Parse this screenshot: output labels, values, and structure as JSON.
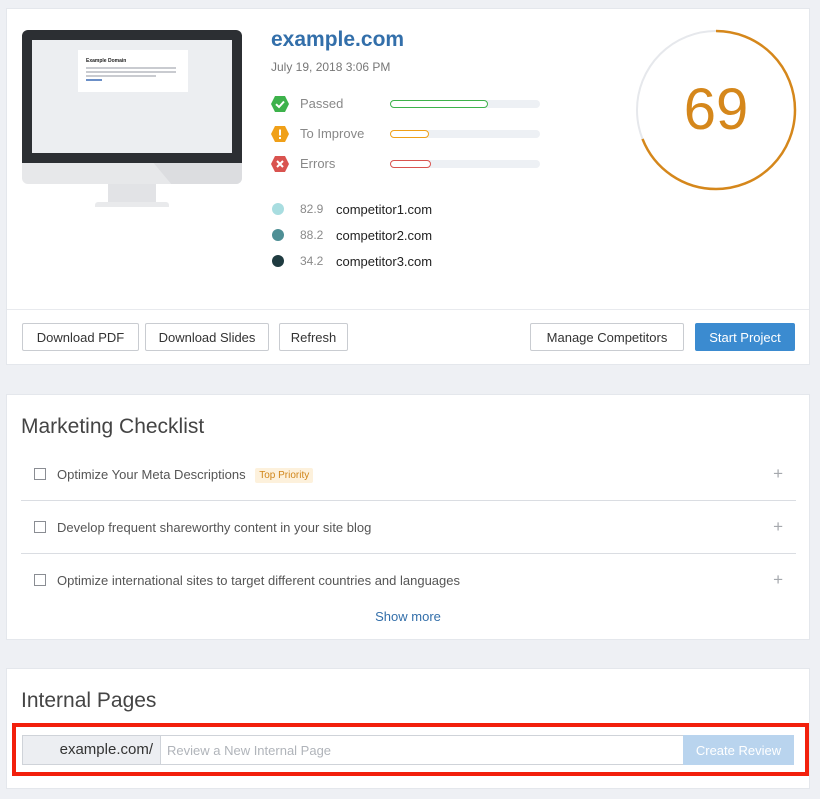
{
  "report": {
    "site_title": "example.com",
    "date": "July 19, 2018 3:06 PM",
    "preview": {
      "heading": "Example Domain"
    },
    "statuses": [
      {
        "label": "Passed",
        "icon": "check-circle-icon",
        "color": "#3db24b",
        "level": 0.65
      },
      {
        "label": "To Improve",
        "icon": "exclamation-circle-icon",
        "color": "#f0a018",
        "level": 0.26
      },
      {
        "label": "Errors",
        "icon": "x-circle-icon",
        "color": "#d9534f",
        "level": 0.27
      }
    ],
    "competitors": [
      {
        "score": "82.9",
        "name": "competitor1.com",
        "color": "#a8dde0"
      },
      {
        "score": "88.2",
        "name": "competitor2.com",
        "color": "#4e8f95"
      },
      {
        "score": "34.2",
        "name": "competitor3.com",
        "color": "#1f3b40"
      }
    ],
    "score": "69",
    "score_color": "#d5871b",
    "score_fraction": 0.69
  },
  "actions": {
    "download_pdf": "Download PDF",
    "download_slides": "Download Slides",
    "refresh": "Refresh",
    "manage_competitors": "Manage Competitors",
    "start_project": "Start Project"
  },
  "checklist": {
    "title": "Marketing Checklist",
    "items": [
      {
        "text": "Optimize Your Meta Descriptions",
        "badge": "Top Priority"
      },
      {
        "text": "Develop frequent shareworthy content in your site blog"
      },
      {
        "text": "Optimize international sites to target different countries and languages"
      }
    ],
    "plus_glyph": "+",
    "show_more": "Show more"
  },
  "internal_pages": {
    "title": "Internal Pages",
    "prefix": "example.com/",
    "placeholder": "Review a New Internal Page",
    "create_button": "Create Review"
  },
  "colors": {
    "accent": "#336faa",
    "primary_button": "#3b8bd0",
    "highlight": "#f2200c"
  }
}
